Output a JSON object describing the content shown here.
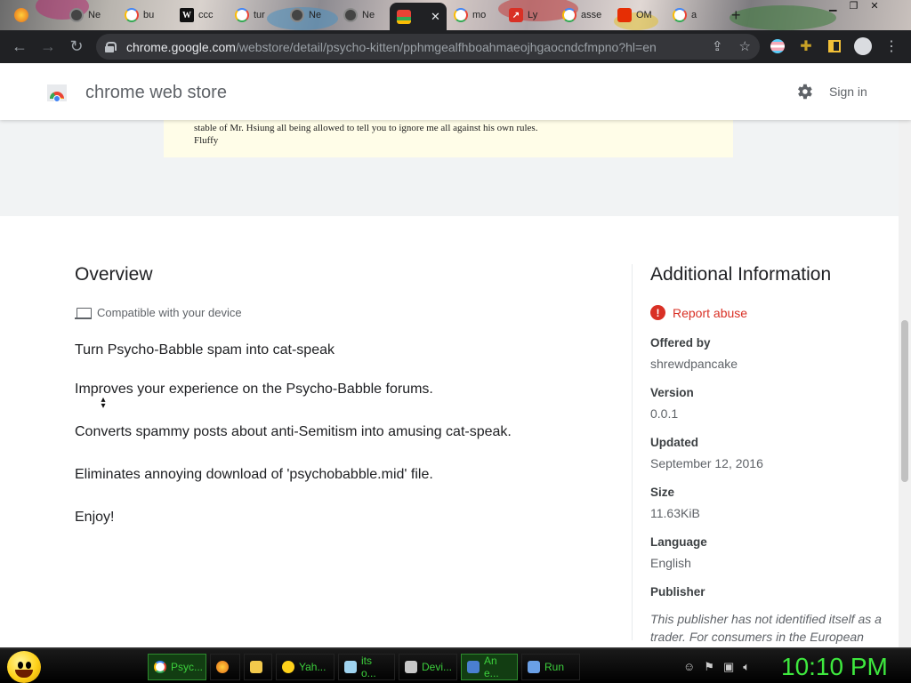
{
  "browser": {
    "tabs": [
      {
        "label": "Ne",
        "icon": "github-icon"
      },
      {
        "label": "bu",
        "icon": "google-icon"
      },
      {
        "label": "ccc",
        "icon": "wikipedia-icon"
      },
      {
        "label": "tur",
        "icon": "google-icon"
      },
      {
        "label": "Ne",
        "icon": "github-icon"
      },
      {
        "label": "Ne",
        "icon": "github-icon"
      },
      {
        "label": "",
        "icon": "chrome-web-store-icon",
        "active": true
      },
      {
        "label": "mo",
        "icon": "google-icon"
      },
      {
        "label": "Ly",
        "icon": "trend-icon"
      },
      {
        "label": "asse",
        "icon": "google-icon"
      },
      {
        "label": "OM",
        "icon": "aliexpress-icon"
      },
      {
        "label": "a",
        "icon": "google-icon"
      }
    ],
    "tab_close_glyph": "✕",
    "new_tab_glyph": "+",
    "url_host": "chrome.google.com",
    "url_path": "/webstore/detail/psycho-kitten/pphmgealfhboahmaeojhgaocndcfmpno?hl=en"
  },
  "store": {
    "title": "chrome web store",
    "signin_label": "Sign in"
  },
  "screenshot_text": {
    "line1": "stable of Mr. Hsiung all being allowed to tell you to ignore me all against his own rules.",
    "line2": "Fluffy"
  },
  "overview": {
    "title": "Overview",
    "compatible": "Compatible with your device",
    "paragraphs": [
      "Turn Psycho-Babble spam into cat-speak",
      "Improves your experience on the Psycho-Babble forums.",
      "Converts spammy posts about anti-Semitism into amusing cat-speak.",
      "Eliminates annoying download of 'psychobabble.mid' file.",
      "Enjoy!"
    ]
  },
  "additional": {
    "title": "Additional Information",
    "report_label": "Report abuse",
    "items": [
      {
        "label": "Offered by",
        "value": "shrewdpancake"
      },
      {
        "label": "Version",
        "value": "0.0.1"
      },
      {
        "label": "Updated",
        "value": "September 12, 2016"
      },
      {
        "label": "Size",
        "value": "11.63KiB"
      },
      {
        "label": "Language",
        "value": "English"
      }
    ],
    "publisher_label": "Publisher",
    "publisher_note": "This publisher has not identified itself as a trader. For consumers in the European"
  },
  "taskbar": {
    "tasks": [
      {
        "label": "Psyc...",
        "icon": "chrome-icon"
      },
      {
        "label": "",
        "icon": "firefox-icon"
      },
      {
        "label": "",
        "icon": "folder-icon"
      },
      {
        "label": "Yah...",
        "icon": "yahoo-messenger-icon"
      },
      {
        "label": "its o...",
        "icon": "notepad-icon"
      },
      {
        "label": "Devi...",
        "icon": "device-manager-icon"
      },
      {
        "label": "An e...",
        "icon": "image-viewer-icon"
      },
      {
        "label": "Run",
        "icon": "run-icon"
      }
    ],
    "clock": "10:10 PM"
  },
  "colors": {
    "accent_red": "#d93025",
    "taskbar_green": "#3ccf3c",
    "clock_green": "#3ee83e",
    "toolbar_dark": "#202124"
  }
}
